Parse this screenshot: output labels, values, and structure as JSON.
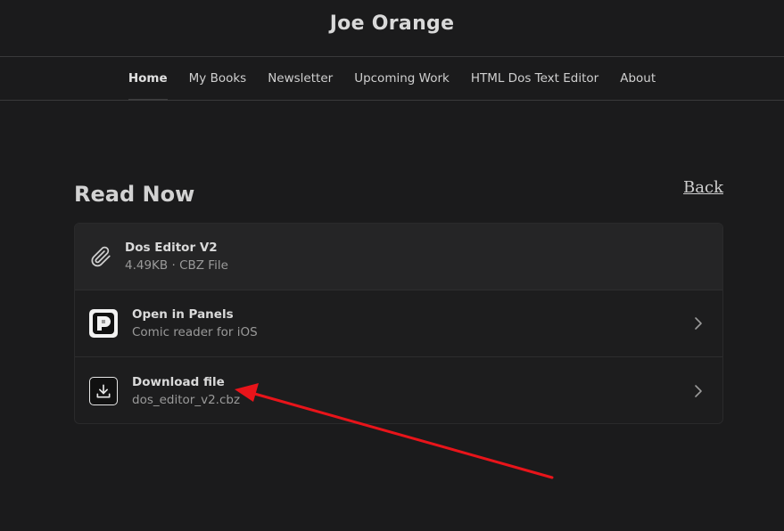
{
  "site": {
    "title": "Joe Orange"
  },
  "nav": {
    "items": [
      {
        "label": "Home",
        "active": true
      },
      {
        "label": "My Books"
      },
      {
        "label": "Newsletter"
      },
      {
        "label": "Upcoming Work"
      },
      {
        "label": "HTML Dos Text Editor"
      },
      {
        "label": "About"
      }
    ]
  },
  "page": {
    "heading": "Read Now",
    "back_label": "Back"
  },
  "file": {
    "name": "Dos Editor V2",
    "size": "4.49KB",
    "separator": "·",
    "type": "CBZ File",
    "icon": "paperclip-icon"
  },
  "actions": [
    {
      "title": "Open in Panels",
      "subtitle": "Comic reader for iOS",
      "icon": "panels-app-icon"
    },
    {
      "title": "Download file",
      "subtitle": "dos_editor_v2.cbz",
      "icon": "download-icon"
    }
  ],
  "annotation": {
    "color": "#e8141a"
  }
}
